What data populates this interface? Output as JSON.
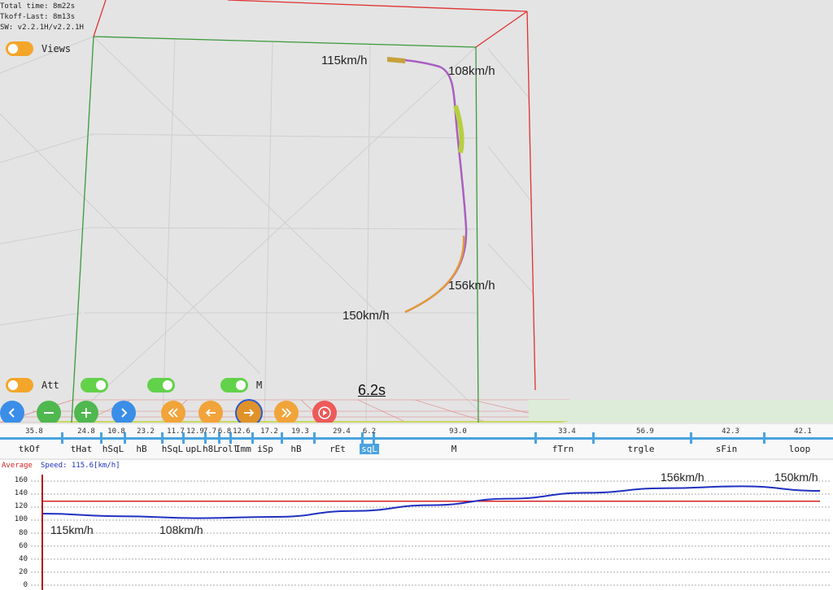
{
  "info": {
    "total_time": "Total time: 8m22s",
    "tkoff_last": "Tkoff-Last: 8m13s",
    "sw": "SW: v2.2.1H/v2.2.1H"
  },
  "toggles": {
    "views_label": "Views",
    "att_label": "Att",
    "m_label": "M"
  },
  "scene": {
    "speed_labels": [
      "115km/h",
      "108km/h",
      "156km/h",
      "150km/h"
    ],
    "time": "6.2s"
  },
  "controls": {
    "icons": [
      "chevron-left-icon",
      "minus-icon",
      "plus-icon",
      "chevron-right-icon",
      "double-left-icon",
      "arrow-left-icon",
      "arrow-right-icon",
      "double-right-icon",
      "play-icon"
    ]
  },
  "segments": {
    "values": [
      "35.8",
      "24.8",
      "10.8",
      "23.2",
      "11.7",
      "12.9",
      "7.7",
      "6.8",
      "12.6",
      "17.2",
      "19.3",
      "29.4",
      "6.2",
      "93.0",
      "33.4",
      "56.9",
      "42.3",
      "42.1"
    ],
    "names": [
      "tkOf",
      "tHat",
      "hSqL",
      "hB",
      "hSqL",
      "upL",
      "h8L",
      "roll",
      "Imm",
      "iSp",
      "hB",
      "rEt",
      "sqL",
      "M",
      "fTrn",
      "trgle",
      "sFin",
      "loop"
    ],
    "active": "sqL"
  },
  "graph": {
    "legend_average": "Average",
    "legend_speed": "Speed: 115.6[km/h]",
    "y_ticks": [
      "160",
      "140",
      "120",
      "100",
      "80",
      "60",
      "40",
      "20",
      "0"
    ],
    "speed_labels": [
      "115km/h",
      "108km/h",
      "156km/h",
      "150km/h"
    ],
    "colors": {
      "average": "#d62020",
      "speed": "#2030c0",
      "cursor": "#b01818"
    }
  },
  "chart_data": {
    "type": "line",
    "title": "",
    "xlabel": "",
    "ylabel": "",
    "ylim": [
      0,
      160
    ],
    "y_ticks": [
      160,
      140,
      120,
      100,
      80,
      60,
      40,
      20,
      0
    ],
    "series": [
      {
        "name": "Speed: 115.6[km/h]",
        "x": [
          0,
          0.1,
          0.2,
          0.3,
          0.4,
          0.5,
          0.6,
          0.7,
          0.8,
          0.9,
          1.0
        ],
        "values": [
          110,
          106,
          103,
          105,
          114,
          123,
          133,
          142,
          149,
          152,
          145
        ]
      },
      {
        "name": "Average",
        "x": [
          0,
          1.0
        ],
        "values": [
          129,
          129
        ]
      }
    ]
  }
}
